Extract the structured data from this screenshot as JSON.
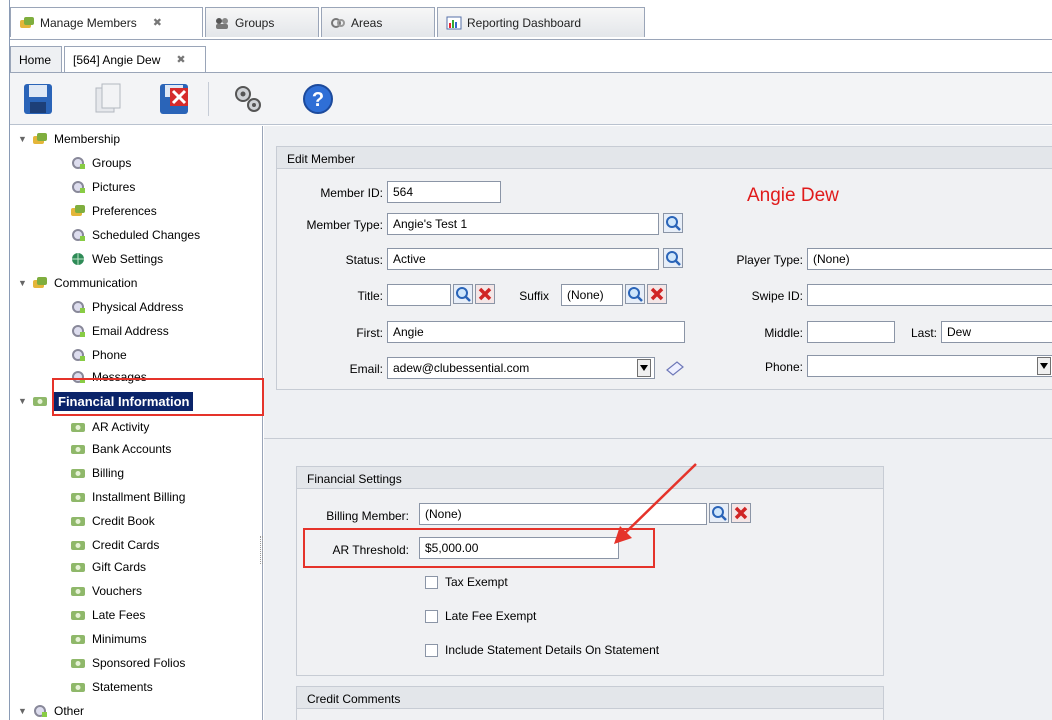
{
  "tabs": {
    "manage_members": "Manage Members",
    "groups": "Groups",
    "areas": "Areas",
    "reporting_dashboard": "Reporting Dashboard",
    "close_glyph": "✖"
  },
  "subtabs": {
    "home": "Home",
    "member": "[564] Angie Dew",
    "close_glyph": "✖"
  },
  "tree": {
    "membership": "Membership",
    "groups": "Groups",
    "pictures": "Pictures",
    "preferences": "Preferences",
    "scheduled_changes": "Scheduled Changes",
    "web_settings": "Web Settings",
    "communication": "Communication",
    "physical_address": "Physical Address",
    "email_address": "Email Address",
    "phone": "Phone",
    "messages": "Messages",
    "financial_information": "Financial Information",
    "ar_activity": "AR Activity",
    "bank_accounts": "Bank Accounts",
    "billing": "Billing",
    "installment_billing": "Installment Billing",
    "credit_book": "Credit Book",
    "credit_cards": "Credit Cards",
    "gift_cards": "Gift Cards",
    "vouchers": "Vouchers",
    "late_fees": "Late Fees",
    "minimums": "Minimums",
    "sponsored_folios": "Sponsored Folios",
    "statements": "Statements",
    "other": "Other"
  },
  "edit_member": {
    "title": "Edit Member",
    "display_name": "Angie Dew",
    "member_id_label": "Member ID:",
    "member_id": "564",
    "member_type_label": "Member Type:",
    "member_type": "Angie's Test 1",
    "status_label": "Status:",
    "status": "Active",
    "player_type_label": "Player Type:",
    "player_type": "(None)",
    "title_label": "Title:",
    "title_value": "",
    "suffix_label": "Suffix",
    "suffix": "(None)",
    "swipe_id_label": "Swipe ID:",
    "swipe_id": "",
    "first_label": "First:",
    "first": "Angie",
    "middle_label": "Middle:",
    "middle": "",
    "last_label": "Last:",
    "last": "Dew",
    "email_label": "Email:",
    "email": "adew@clubessential.com",
    "phone_label": "Phone:",
    "phone": ""
  },
  "financial": {
    "title": "Financial Settings",
    "billing_member_label": "Billing Member:",
    "billing_member": "(None)",
    "ar_threshold_label": "AR Threshold:",
    "ar_threshold": "$5,000.00",
    "tax_exempt": "Tax Exempt",
    "late_fee_exempt": "Late Fee Exempt",
    "include_statement_details": "Include Statement Details On Statement"
  },
  "credit_comments": {
    "title": "Credit Comments"
  },
  "colors": {
    "highlight": "#e5332a",
    "selection": "#0a246a",
    "name": "#e01b1b"
  }
}
